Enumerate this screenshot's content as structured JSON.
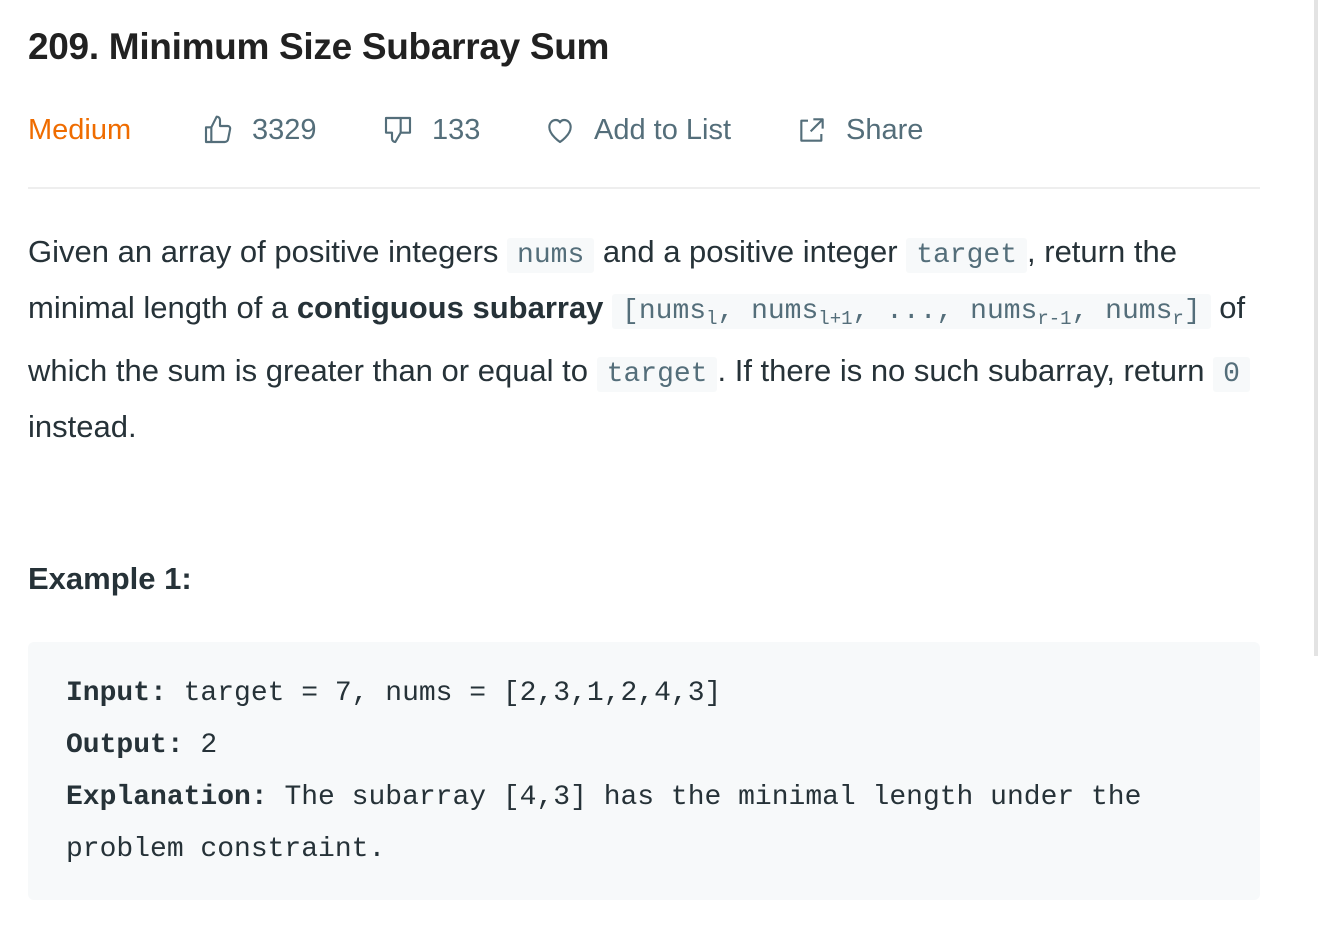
{
  "problem": {
    "title": "209. Minimum Size Subarray Sum",
    "difficulty": "Medium",
    "likes": "3329",
    "dislikes": "133",
    "add_to_list_label": "Add to List",
    "share_label": "Share"
  },
  "colors": {
    "difficulty_medium": "#ef6c00",
    "meta_text": "#546e7a",
    "code_background": "#f7f9fa"
  },
  "icons": {
    "likes": "thumbs-up-icon",
    "dislikes": "thumbs-down-icon",
    "add_to_list": "heart-icon",
    "share": "share-icon"
  },
  "description": {
    "t1": "Given an array of positive integers ",
    "c_nums": "nums",
    "t2": " and a positive integer ",
    "c_target": "target",
    "t3": ", return the minimal length of a ",
    "bold": "contiguous subarray",
    "t4": " ",
    "c_range_open": "[nums",
    "sub_l": "l",
    "c_range_sep1": ", nums",
    "sub_l1": "l+1",
    "c_range_sep2": ", ..., nums",
    "sub_r1": "r-1",
    "c_range_sep3": ", nums",
    "sub_r": "r",
    "c_range_close": "]",
    "t5": " of which the sum is greater than or equal to ",
    "c_target2": "target",
    "t6": ". If there is no such subarray, return ",
    "c_zero": "0",
    "t7": " instead."
  },
  "example1": {
    "heading": "Example 1:",
    "input_label": "Input:",
    "input_value": " target = 7, nums = [2,3,1,2,4,3]",
    "output_label": "Output:",
    "output_value": " 2",
    "explanation_label": "Explanation:",
    "explanation_value": " The subarray [4,3] has the minimal length under the problem constraint."
  }
}
